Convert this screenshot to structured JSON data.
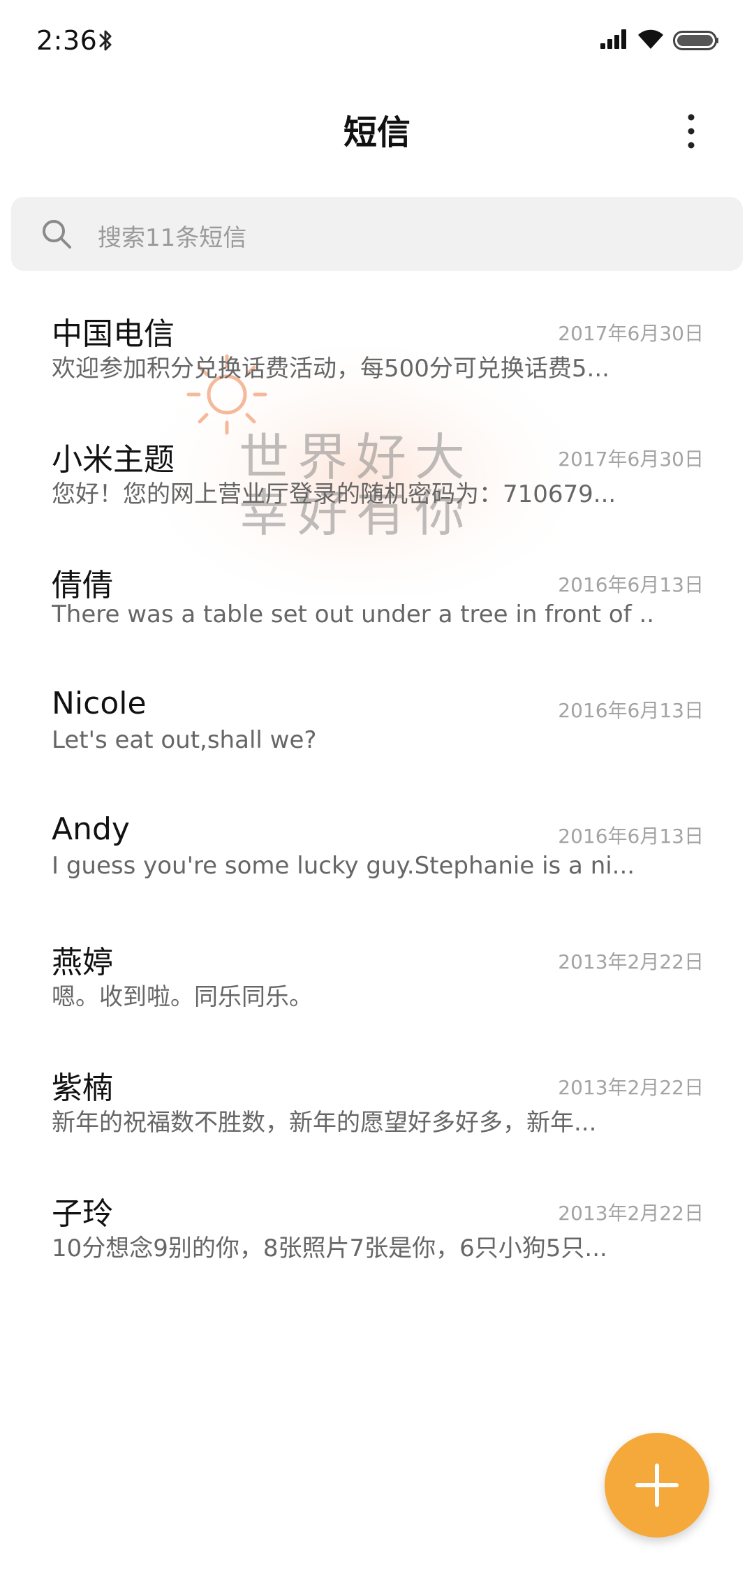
{
  "status_bar": {
    "time": "2:36",
    "icons": [
      "bluetooth-icon",
      "signal-icon",
      "wifi-icon",
      "battery-icon"
    ]
  },
  "header": {
    "title": "短信",
    "menu_icon": "more-vertical-icon"
  },
  "search": {
    "placeholder": "搜索11条短信",
    "icon": "search-icon"
  },
  "messages": [
    {
      "name": "中国电信",
      "date": "2017年6月30日",
      "preview": "欢迎参加积分兑换话费活动，每500分可兑换话费5..."
    },
    {
      "name": "小米主题",
      "date": "2017年6月30日",
      "preview": "您好！您的网上营业厅登录的随机密码为：710679..."
    },
    {
      "name": "倩倩",
      "date": "2016年6月13日",
      "preview": "There was a table set out under a tree in front of ..."
    },
    {
      "name": "Nicole",
      "date": "2016年6月13日",
      "preview": "Let's eat out,shall we?"
    },
    {
      "name": "Andy",
      "date": "2016年6月13日",
      "preview": "I guess you're some lucky guy.Stephanie is a ni..."
    },
    {
      "name": "燕婷",
      "date": "2013年2月22日",
      "preview": "嗯。收到啦。同乐同乐。"
    },
    {
      "name": "紫楠",
      "date": "2013年2月22日",
      "preview": "新年的祝福数不胜数，新年的愿望好多好多，新年..."
    },
    {
      "name": "子玲",
      "date": "2013年2月22日",
      "preview": "10分想念9别的你，8张照片7张是你，6只小狗5只..."
    }
  ],
  "watermark": {
    "line1": "世界好大",
    "line2": "幸好有你"
  },
  "fab": {
    "icon": "plus-icon",
    "color": "#f5a93a"
  }
}
